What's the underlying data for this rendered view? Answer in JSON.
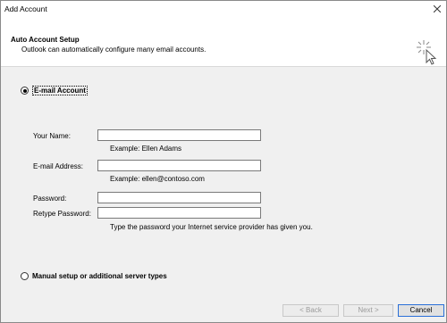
{
  "window": {
    "title": "Add Account"
  },
  "header": {
    "title": "Auto Account Setup",
    "subtitle": "Outlook can automatically configure many email accounts."
  },
  "options": {
    "email_account": {
      "label": "E-mail Account",
      "selected": true
    },
    "manual_setup": {
      "label": "Manual setup or additional server types",
      "selected": false
    }
  },
  "form": {
    "your_name": {
      "label": "Your Name:",
      "value": "",
      "hint": "Example: Ellen Adams"
    },
    "email_address": {
      "label": "E-mail Address:",
      "value": "",
      "hint": "Example: ellen@contoso.com"
    },
    "password": {
      "label": "Password:",
      "value": ""
    },
    "retype_password": {
      "label": "Retype Password:",
      "value": "",
      "hint": "Type the password your Internet service provider has given you."
    }
  },
  "footer": {
    "back_label": "< Back",
    "next_label": "Next >",
    "cancel_label": "Cancel"
  },
  "colors": {
    "dialog_bg": "#f0f0f0",
    "header_bg": "#ffffff",
    "default_button_border": "#2a6fd8",
    "disabled_text": "#9a9a9a"
  },
  "icons": {
    "close": "close-icon",
    "wizard": "sparkle-cursor-icon"
  }
}
